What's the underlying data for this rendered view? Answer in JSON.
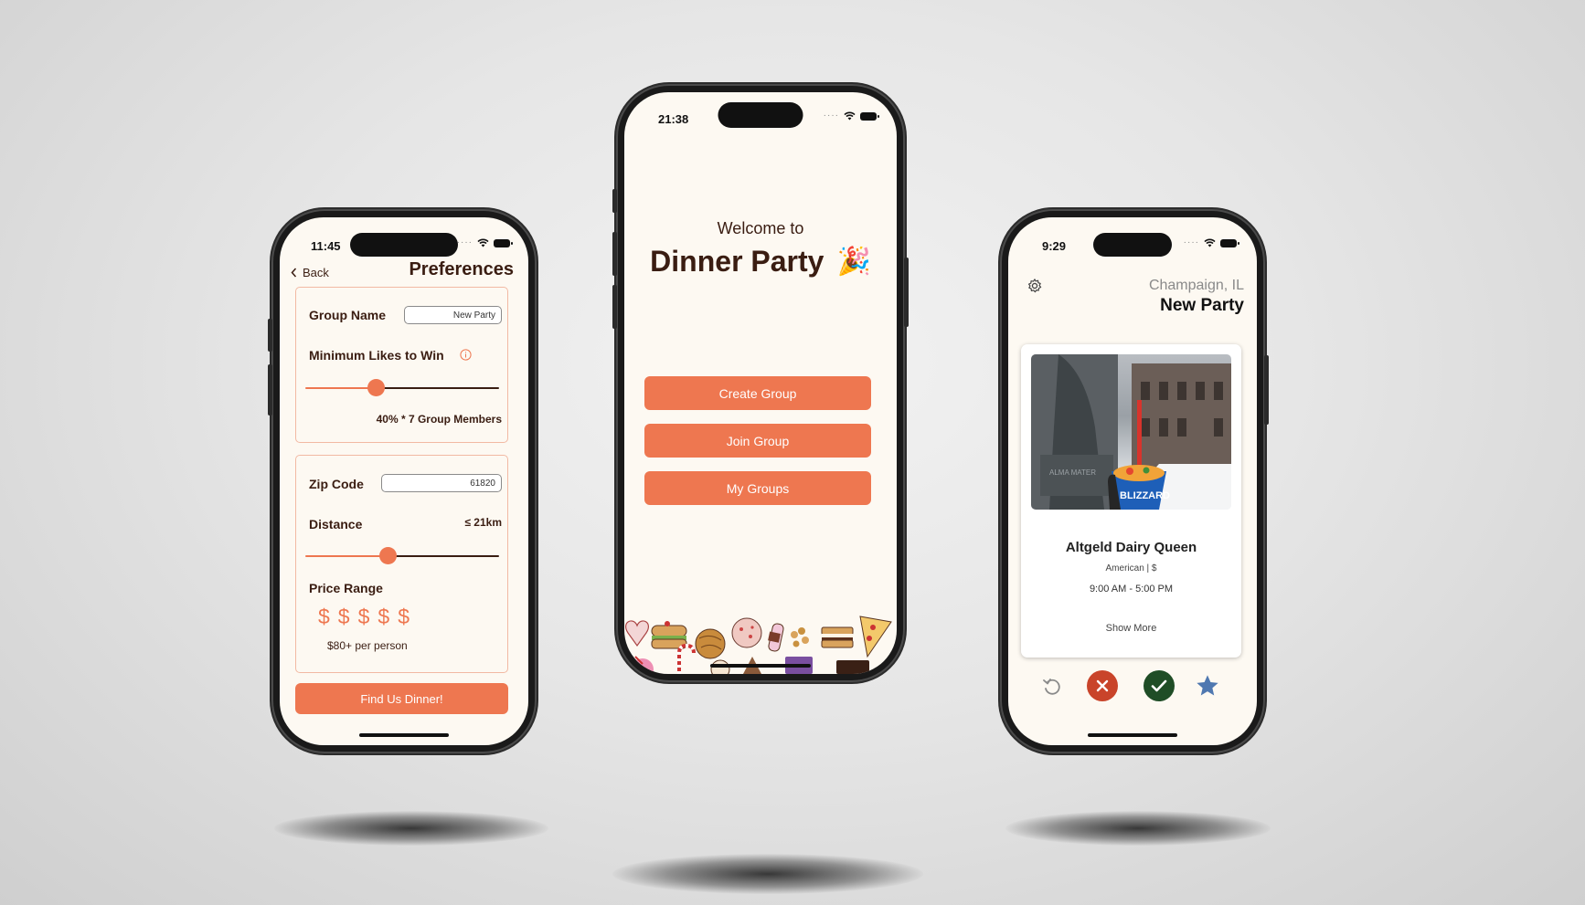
{
  "phone_left": {
    "time": "11:45",
    "back_label": "Back",
    "title": "Preferences",
    "group_name_label": "Group Name",
    "group_name_value": "New Party",
    "min_likes_label": "Minimum Likes to Win",
    "min_likes_percent": 0.35,
    "min_likes_summary": "40% * 7 Group Members",
    "zip_label": "Zip Code",
    "zip_value": "61820",
    "distance_label": "Distance",
    "distance_value": "≤ 21km",
    "distance_percent": 0.42,
    "price_label": "Price Range",
    "price_symbols": [
      "$",
      "$",
      "$",
      "$",
      "$"
    ],
    "price_caption": "$80+ per person",
    "find_button": "Find Us Dinner!"
  },
  "phone_center": {
    "time": "21:38",
    "welcome": "Welcome to",
    "app_name": "Dinner Party",
    "party_emoji": "🎉",
    "buttons": [
      "Create Group",
      "Join Group",
      "My Groups"
    ]
  },
  "phone_right": {
    "time": "9:29",
    "location": "Champaign, IL",
    "party_name": "New Party",
    "restaurant_name": "Altgeld Dairy Queen",
    "restaurant_meta": "American | $",
    "restaurant_hours": "9:00 AM - 5:00 PM",
    "show_more": "Show More",
    "photo_text": "BLIZZARD"
  },
  "colors": {
    "accent": "#ee7750",
    "screen_bg": "#fdf9f2",
    "text_dark": "#3a1d12",
    "reject": "#c9442a",
    "accept": "#1f4d26",
    "star": "#4f78b0"
  }
}
